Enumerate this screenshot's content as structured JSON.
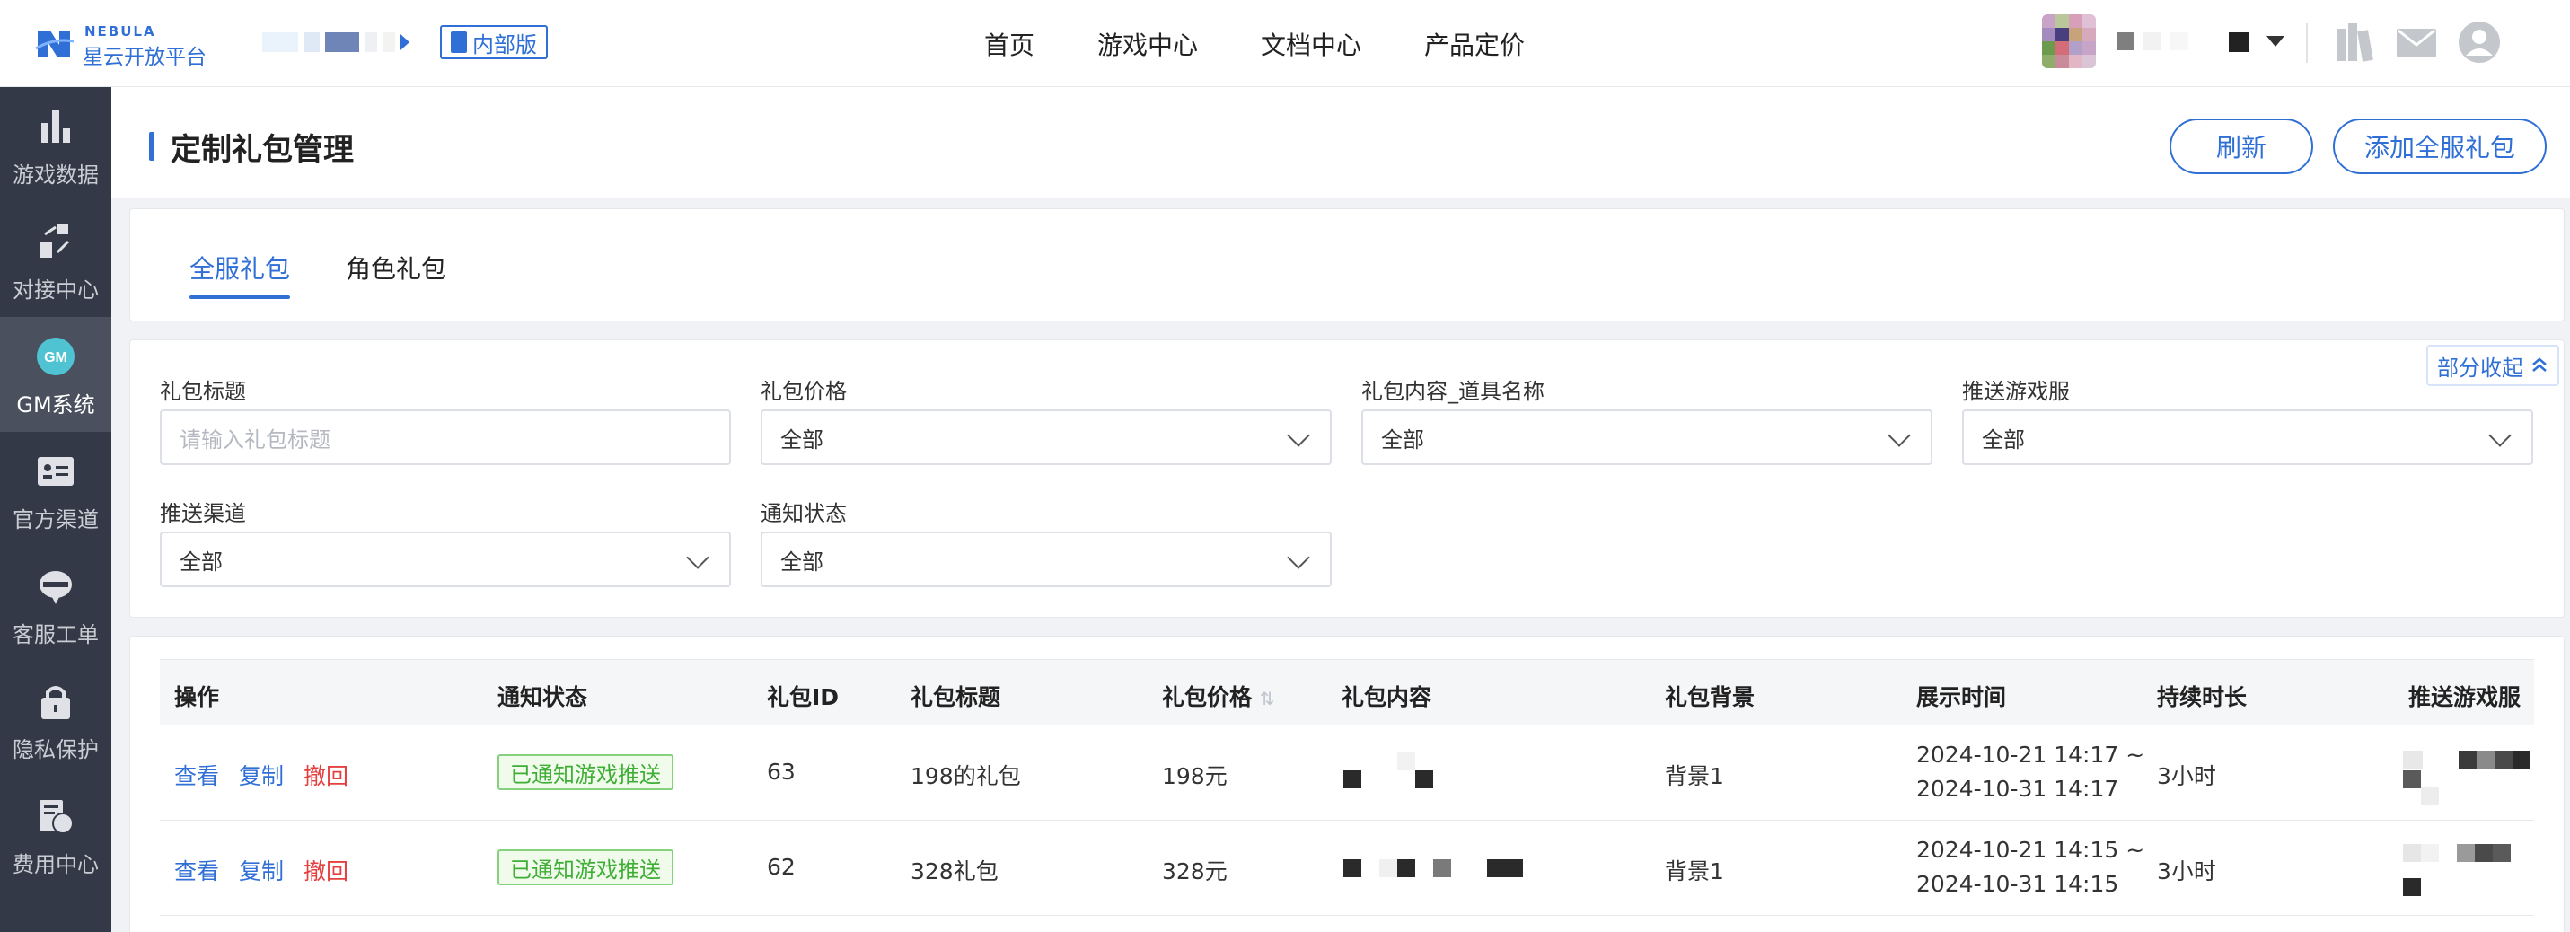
{
  "brand": {
    "name_en": "NEBULA",
    "name_cn": "星云开放平台"
  },
  "env_badge": "内部版",
  "nav": [
    "首页",
    "游戏中心",
    "文档中心",
    "产品定价"
  ],
  "sidebar": [
    {
      "label": "游戏数据",
      "icon": "bar-chart-icon"
    },
    {
      "label": "对接中心",
      "icon": "connect-icon"
    },
    {
      "label": "GM系统",
      "icon": "gm-icon",
      "icon_text": "GM",
      "active": true
    },
    {
      "label": "官方渠道",
      "icon": "id-card-icon"
    },
    {
      "label": "客服工单",
      "icon": "support-icon"
    },
    {
      "label": "隐私保护",
      "icon": "lock-icon"
    },
    {
      "label": "费用中心",
      "icon": "billing-icon"
    }
  ],
  "page": {
    "title": "定制礼包管理",
    "refresh_label": "刷新",
    "add_label": "添加全服礼包"
  },
  "tabs": [
    {
      "label": "全服礼包",
      "active": true
    },
    {
      "label": "角色礼包",
      "active": false
    }
  ],
  "filters": {
    "collapse_label": "部分收起",
    "title": {
      "label": "礼包标题",
      "placeholder": "请输入礼包标题"
    },
    "price": {
      "label": "礼包价格",
      "value": "全部"
    },
    "item_name": {
      "label": "礼包内容_道具名称",
      "value": "全部"
    },
    "server": {
      "label": "推送游戏服",
      "value": "全部"
    },
    "channel": {
      "label": "推送渠道",
      "value": "全部"
    },
    "notify": {
      "label": "通知状态",
      "value": "全部"
    }
  },
  "table": {
    "columns": [
      "操作",
      "通知状态",
      "礼包ID",
      "礼包标题",
      "礼包价格",
      "礼包内容",
      "礼包背景",
      "展示时间",
      "持续时长",
      "推送游戏服"
    ],
    "actions": {
      "view": "查看",
      "copy": "复制",
      "revoke": "撤回"
    },
    "rows": [
      {
        "status": "已通知游戏推送",
        "id": "63",
        "title": "198的礼包",
        "price": "198元",
        "background": "背景1",
        "time_start": "2024-10-21 14:17 ~",
        "time_end": "2024-10-31 14:17",
        "duration": "3小时"
      },
      {
        "status": "已通知游戏推送",
        "id": "62",
        "title": "328礼包",
        "price": "328元",
        "background": "背景1",
        "time_start": "2024-10-21 14:15 ~",
        "time_end": "2024-10-31 14:15",
        "duration": "3小时"
      }
    ]
  },
  "colors": {
    "accent": "#2f6fd6",
    "sidebar_bg": "#333946",
    "success": "#3fae35",
    "danger": "#e54040"
  }
}
